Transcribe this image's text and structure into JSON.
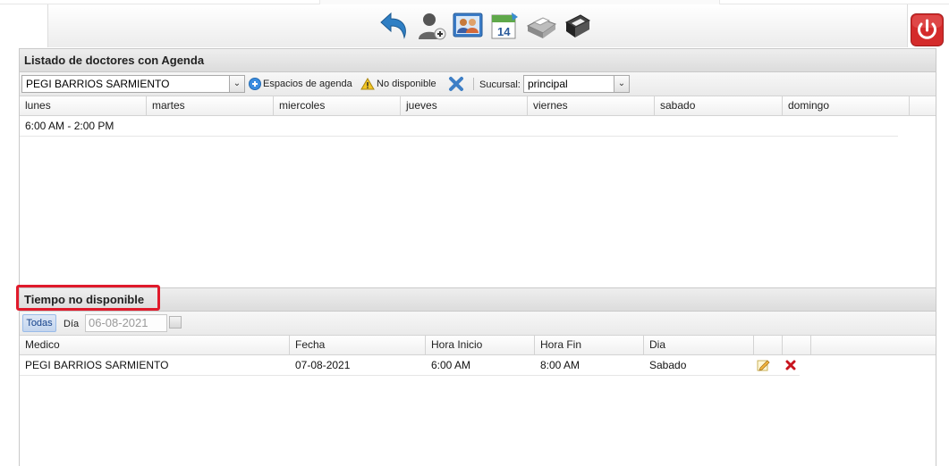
{
  "toolbar": {
    "icons": [
      "back-arrow-icon",
      "add-user-icon",
      "users-group-icon",
      "calendar-icon",
      "printer-icon",
      "cash-register-icon"
    ],
    "power_icon": "power-off-icon"
  },
  "agenda_panel": {
    "title": "Listado de doctores con Agenda",
    "doctor_select": "PEGI BARRIOS SARMIENTO",
    "espacios_label": "Espacios de agenda",
    "no_disponible_label": "No disponible",
    "sucursal_label": "Sucursal:",
    "sucursal_value": "principal",
    "columns": [
      "lunes",
      "martes",
      "miercoles",
      "jueves",
      "viernes",
      "sabado",
      "domingo"
    ],
    "rows": [
      [
        "6:00 AM - 2:00 PM",
        "",
        "",
        "",
        "",
        "",
        ""
      ]
    ]
  },
  "unavailable_panel": {
    "title": "Tiempo no disponible",
    "todas_label": "Todas",
    "dia_label": "Día",
    "date_value": "06-08-2021",
    "columns": [
      "Medico",
      "Fecha",
      "Hora Inicio",
      "Hora Fin",
      "Dia",
      "",
      ""
    ],
    "rows": [
      {
        "medico": "PEGI BARRIOS SARMIENTO",
        "fecha": "07-08-2021",
        "hora_inicio": "6:00 AM",
        "hora_fin": "8:00 AM",
        "dia": "Sabado"
      }
    ]
  },
  "colors": {
    "accent_red": "#e01a2b",
    "power_red": "#d42b2b",
    "header_blue": "#2a6fb5"
  }
}
